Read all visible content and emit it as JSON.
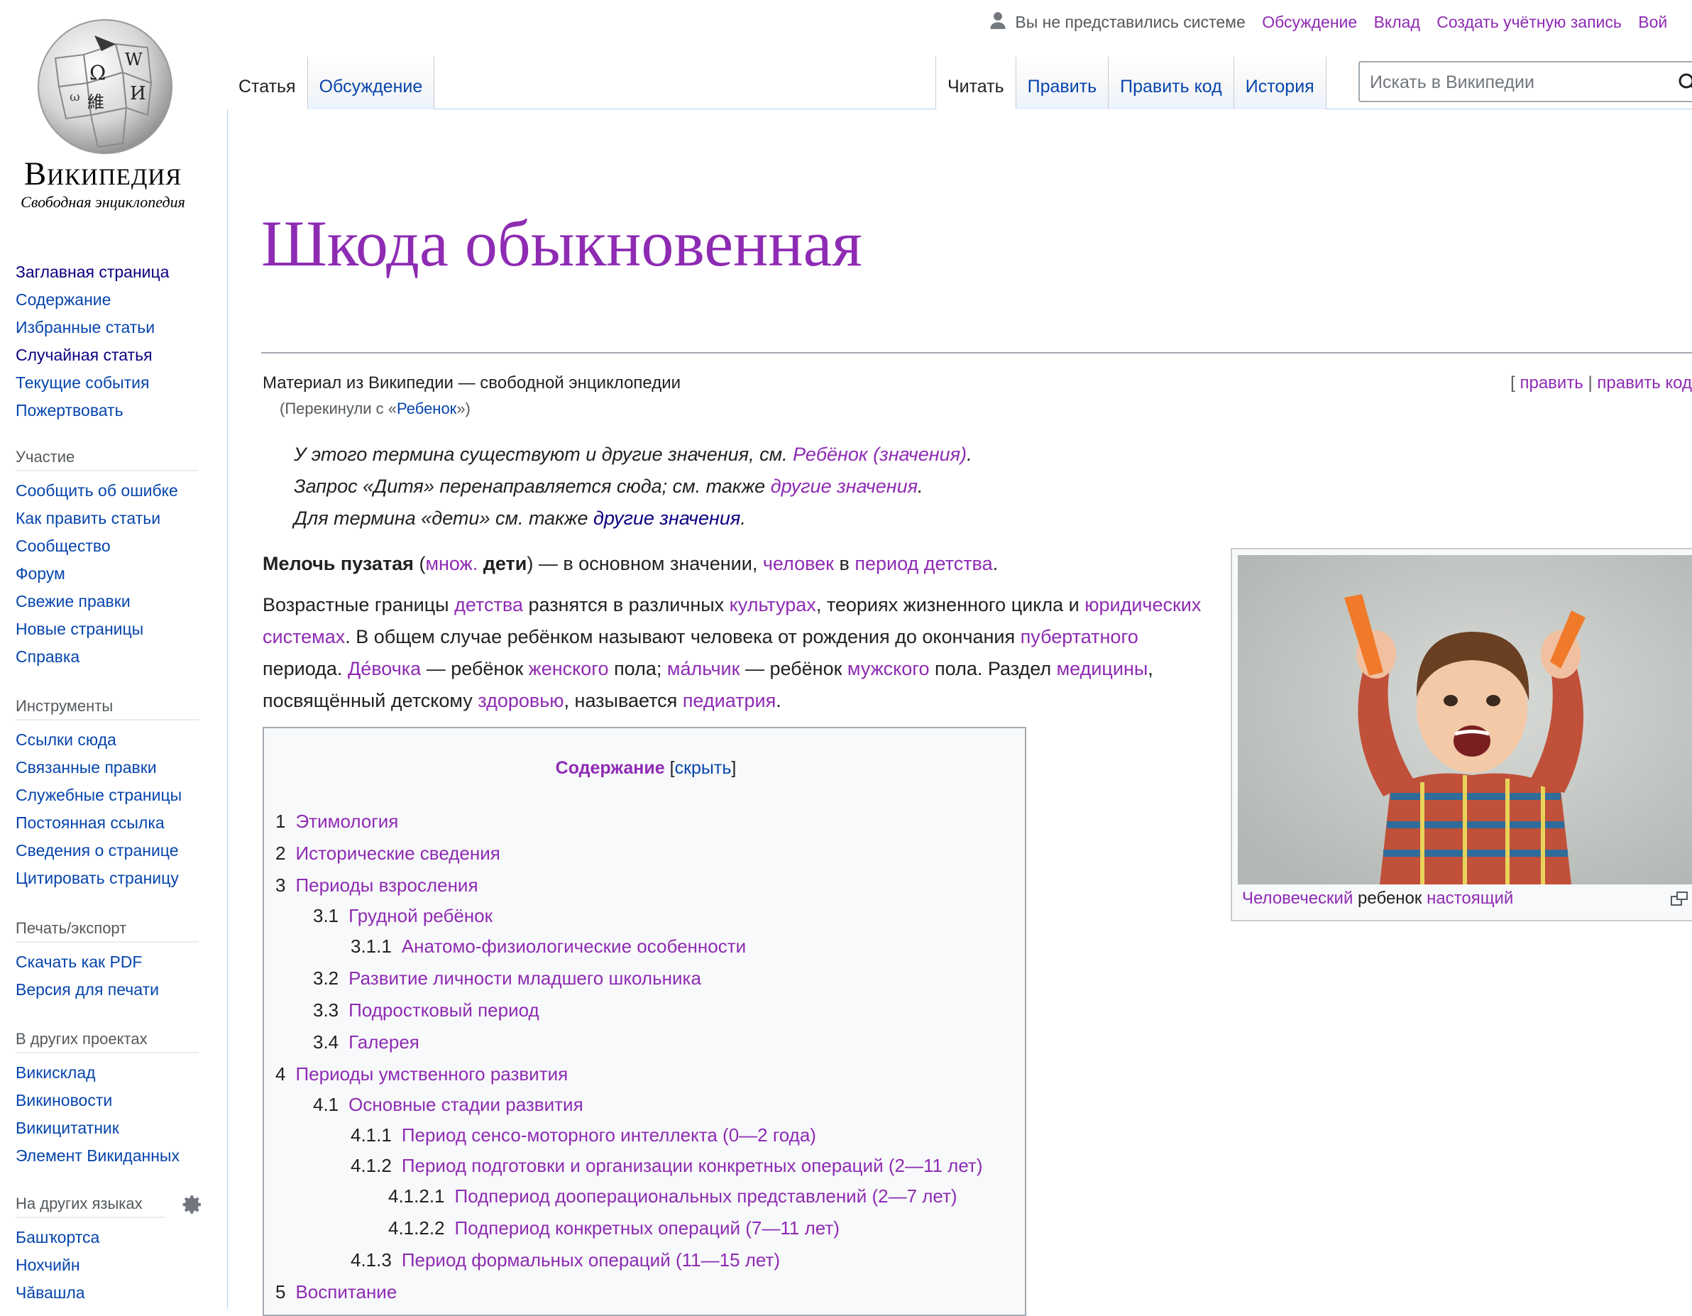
{
  "logo": {
    "wordmark": "Википедия",
    "tagline": "Свободная энциклопедия",
    "globe_glyphs": [
      "Ω",
      "W",
      "И",
      "維",
      "ω"
    ]
  },
  "nav_main": [
    {
      "label": "Заглавная страница",
      "visited": false,
      "dark": true
    },
    {
      "label": "Содержание",
      "visited": false
    },
    {
      "label": "Избранные статьи",
      "visited": false
    },
    {
      "label": "Случайная статья",
      "visited": false,
      "dark": true
    },
    {
      "label": "Текущие события",
      "visited": false
    },
    {
      "label": "Пожертвовать",
      "visited": false
    }
  ],
  "nav_participation": {
    "heading": "Участие",
    "items": [
      "Сообщить об ошибке",
      "Как править статьи",
      "Сообщество",
      "Форум",
      "Свежие правки",
      "Новые страницы",
      "Справка"
    ]
  },
  "nav_tools": {
    "heading": "Инструменты",
    "items": [
      "Ссылки сюда",
      "Связанные правки",
      "Служебные страницы",
      "Постоянная ссылка",
      "Сведения о странице",
      "Цитировать страницу"
    ]
  },
  "nav_print": {
    "heading": "Печать/экспорт",
    "items": [
      "Скачать как PDF",
      "Версия для печати"
    ]
  },
  "nav_projects": {
    "heading": "В других проектах",
    "items": [
      "Викисклад",
      "Викиновости",
      "Викицитатник",
      "Элемент Викиданных"
    ]
  },
  "nav_languages": {
    "heading": "На других языках",
    "items": [
      "Башҡортса",
      "Нохчийн",
      "Чӑвашла"
    ]
  },
  "personal": {
    "not_logged": "Вы не представились системе",
    "talk": "Обсуждение",
    "contributions": "Вклад",
    "create_account": "Создать учётную запись",
    "login": "Вой"
  },
  "tabs": {
    "article": "Статья",
    "discussion": "Обсуждение",
    "read": "Читать",
    "edit": "Править",
    "edit_source": "Править код",
    "history": "История"
  },
  "search": {
    "placeholder": "Искать в Википедии"
  },
  "article": {
    "title": "Шкода обыкновенная",
    "site_sub": "Материал из Википедии — свободной энциклопедии",
    "redirect_prefix": "(Перекинули с «",
    "redirect_link": "Ребенок",
    "redirect_suffix": "»)",
    "edit_open": "[",
    "edit": "править",
    "edit_sep": "|",
    "edit_source": "править код",
    "hatnote1_text": "У этого термина существуют и другие значения, см. ",
    "hatnote1_link": "Ребёнок (значения)",
    "hatnote1_end": ".",
    "hatnote2_text": "Запрос «Дитя» перенаправляется сюда; см. также ",
    "hatnote2_link": "другие значения",
    "hatnote2_end": ".",
    "hatnote3_text": "Для термина «дети» см. также ",
    "hatnote3_link": "другие значения",
    "hatnote3_end": ".",
    "p1": {
      "bold1": "Мелочь пузатая",
      "t1": " (",
      "link1": "множ.",
      "t2": " ",
      "bold2": "дети",
      "t3": ") — в основном значении, ",
      "link2": "человек",
      "t4": " в ",
      "link3": "период детства",
      "t5": "."
    },
    "p2": {
      "t1": "Возрастные границы ",
      "l1": "детства",
      "t2": " разнятся в различных ",
      "l2": "культурах",
      "t3": ", теориях жизненного цикла и ",
      "l3": "юридических системах",
      "t4": ". В общем случае ребёнком называют человека от рождения до окончания ",
      "l4": "пубертатного",
      "t5": " периода. ",
      "l5": "Де́вочка",
      "t6": " — ребёнок ",
      "l6": "женского",
      "t7": " пола; ",
      "l7": "ма́льчик",
      "t8": " — ребёнок ",
      "l8": "мужского",
      "t9": " пола. Раздел ",
      "l9": "медицины",
      "t10": ", посвящённый детскому ",
      "l10": "здоровью",
      "t11": ", называется ",
      "l11": "педиатрия",
      "t12": "."
    }
  },
  "toc": {
    "title": "Содержание",
    "toggle_open": "[",
    "toggle": "скрыть",
    "toggle_close": "]",
    "items": [
      {
        "num": "1",
        "label": "Этимология"
      },
      {
        "num": "2",
        "label": "Исторические сведения"
      },
      {
        "num": "3",
        "label": "Периоды взросления"
      },
      {
        "num": "3.1",
        "label": "Грудной ребёнок"
      },
      {
        "num": "3.1.1",
        "label": "Анатомо-физиологические особенности"
      },
      {
        "num": "3.2",
        "label": "Развитие личности младшего школьника"
      },
      {
        "num": "3.3",
        "label": "Подростковый период"
      },
      {
        "num": "3.4",
        "label": "Галерея"
      },
      {
        "num": "4",
        "label": "Периоды умственного развития"
      },
      {
        "num": "4.1",
        "label": "Основные стадии развития"
      },
      {
        "num": "4.1.1",
        "label": "Период сенсо-моторного интеллекта (0—2 года)"
      },
      {
        "num": "4.1.2",
        "label": "Период подготовки и организации конкретных операций (2—11 лет)"
      },
      {
        "num": "4.1.2.1",
        "label": "Подпериод дооперациональных представлений (2—7 лет)"
      },
      {
        "num": "4.1.2.2",
        "label": "Подпериод конкретных операций (7—11 лет)"
      },
      {
        "num": "4.1.3",
        "label": "Период формальных операций (11—15 лет)"
      },
      {
        "num": "5",
        "label": "Воспитание"
      }
    ]
  },
  "thumbnail": {
    "caption_link1": "Человеческий",
    "caption_text": " ребенок ",
    "caption_link2": "настоящий"
  },
  "colors": {
    "link": "#0645ad",
    "visited": "#8e2bb3",
    "text": "#202122",
    "border": "#a7d7f9"
  }
}
